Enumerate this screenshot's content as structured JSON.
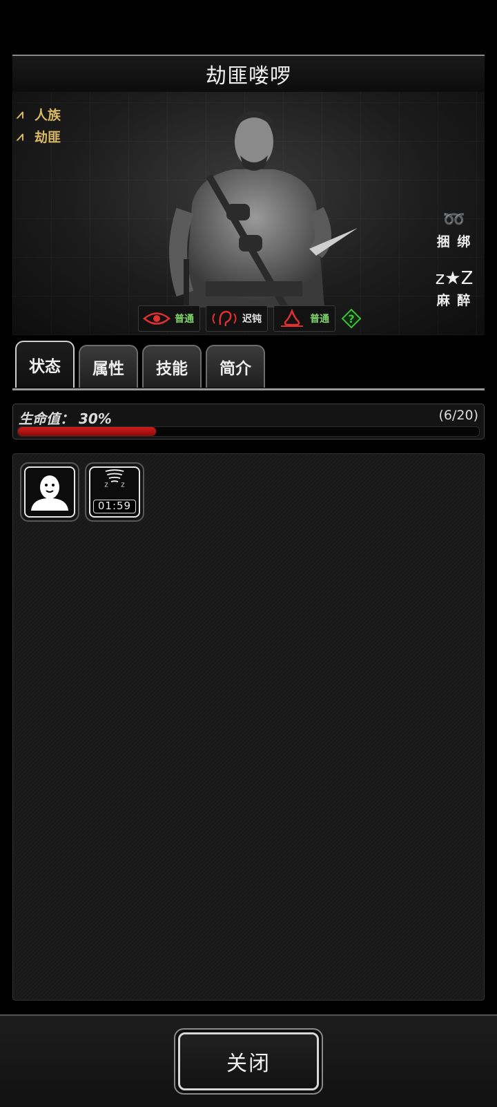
{
  "title": "劫匪喽啰",
  "tags": [
    {
      "icon": "branch-icon",
      "label": "人族"
    },
    {
      "icon": "branch-icon",
      "label": "劫匪"
    }
  ],
  "side_actions": [
    {
      "icon": "rope-icon",
      "label": "捆 绑"
    },
    {
      "icon": "sleep-icon",
      "label": "麻 醉"
    }
  ],
  "senses": [
    {
      "icon": "eye-icon",
      "value": "普通",
      "value_color": "#7fd36a"
    },
    {
      "icon": "ear-icon",
      "value": "迟钝",
      "value_color": "#e6e6e6"
    },
    {
      "icon": "smell-icon",
      "value": "普通",
      "value_color": "#7fd36a"
    }
  ],
  "tabs": [
    "状态",
    "属性",
    "技能",
    "简介"
  ],
  "active_tab": 0,
  "health": {
    "label": "生命值： 30%",
    "count": "(6/20)",
    "fraction": 0.3,
    "color": "#c81414"
  },
  "effects": [
    {
      "icon": "person-icon",
      "timer": ""
    },
    {
      "icon": "dizzy-tornado-icon",
      "timer": "01:59"
    }
  ],
  "close_label": "关闭"
}
